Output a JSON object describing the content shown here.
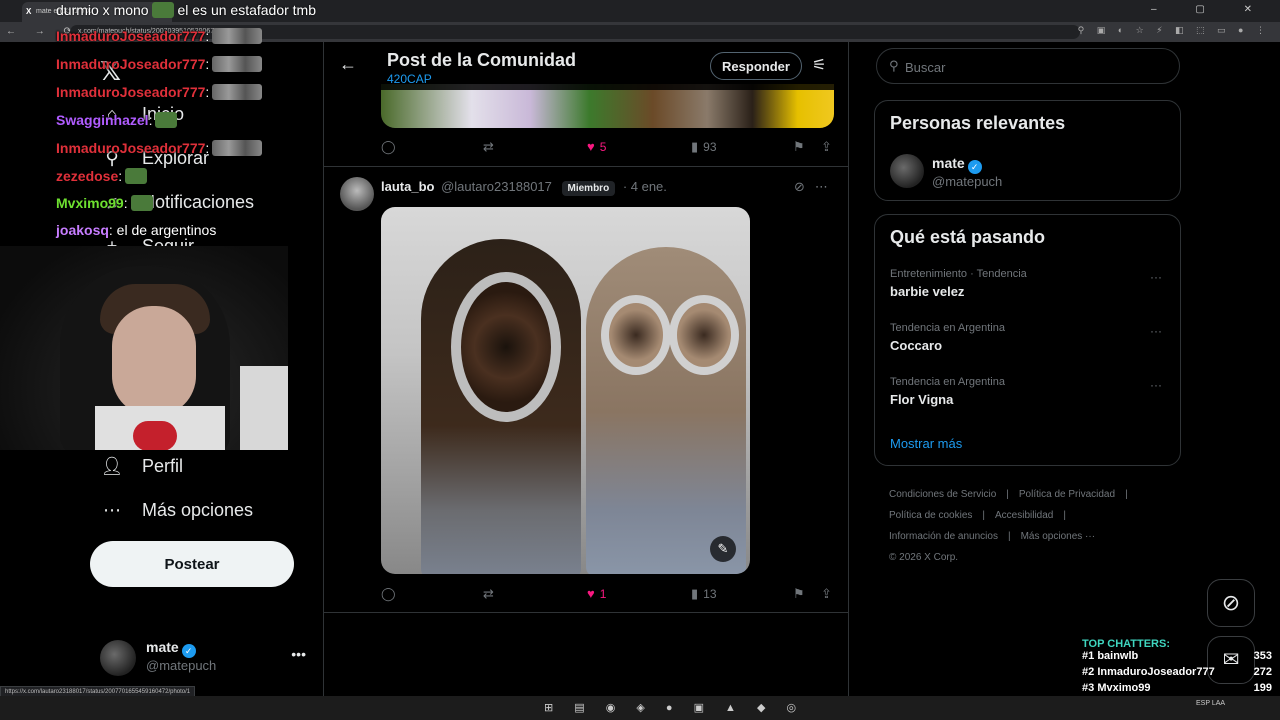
{
  "browser": {
    "tab_title": "mate en X: \"1\" / X",
    "url": "x.com/matepuch/status/2007039510539067771",
    "status_url": "https://x.com/lautaro23188017/status/2007701655459160472/photo/1"
  },
  "stream": {
    "top_message_user": "durmio x mono",
    "top_message_text": "el es un estafador tmb",
    "chat": [
      {
        "user": "InmaduroJoseador777",
        "color": "#e0303a",
        "text": ":"
      },
      {
        "user": "InmaduroJoseador777",
        "color": "#e0303a",
        "text": ":"
      },
      {
        "user": "InmaduroJoseador777",
        "color": "#e0303a",
        "text": ":"
      },
      {
        "user": "Swagginhazel",
        "color": "#b05cff",
        "text": ":"
      },
      {
        "user": "InmaduroJoseador777",
        "color": "#e0303a",
        "text": ":"
      },
      {
        "user": "zezedose",
        "color": "#e0303a",
        "text": ":"
      },
      {
        "user": "Mvximo99",
        "color": "#6ee030",
        "text": ":"
      },
      {
        "user": "joakosq",
        "color": "#c77dff",
        "text": ": el de argentinos"
      }
    ],
    "top_chatters_title": "TOP CHATTERS:",
    "top_chatters": [
      {
        "rank": "#1",
        "name": "bainwlb",
        "count": "353"
      },
      {
        "rank": "#2",
        "name": "InmaduroJoseador777",
        "count": "272"
      },
      {
        "rank": "#3",
        "name": "Mvximo99",
        "count": "199"
      }
    ]
  },
  "sidebar": {
    "items": [
      {
        "label": "Inicio",
        "icon": "home-icon"
      },
      {
        "label": "Explorar",
        "icon": "search-icon"
      },
      {
        "label": "Notificaciones",
        "icon": "bell-icon"
      },
      {
        "label": "Seguir",
        "icon": "follow-icon"
      },
      {
        "label": "Perfil",
        "icon": "person-icon"
      },
      {
        "label": "Más opciones",
        "icon": "more-circle-icon"
      }
    ],
    "post_button": "Postear",
    "account": {
      "name": "mate",
      "handle": "@matepuch"
    }
  },
  "header": {
    "title": "Post de la Comunidad",
    "subtitle": "420CAP",
    "reply_button": "Responder"
  },
  "prev_post": {
    "likes": "5",
    "views": "93"
  },
  "post": {
    "user": "lauta_bo",
    "handle": "@lautaro23188017",
    "badge": "Miembro",
    "date": "· 4 ene.",
    "likes": "1",
    "views": "13"
  },
  "search": {
    "placeholder": "Buscar"
  },
  "relevant": {
    "title": "Personas relevantes",
    "name": "mate",
    "handle": "@matepuch"
  },
  "trends": {
    "title": "Qué está pasando",
    "items": [
      {
        "meta": "Entretenimiento · Tendencia",
        "name": "barbie velez"
      },
      {
        "meta": "Tendencia en Argentina",
        "name": "Coccaro"
      },
      {
        "meta": "Tendencia en Argentina",
        "name": "Flor Vigna"
      }
    ],
    "show_more": "Mostrar más"
  },
  "footer": {
    "links": [
      "Condiciones de Servicio",
      "|",
      "Política de Privacidad",
      "|",
      "Política de cookies",
      "|",
      "Accesibilidad",
      "|",
      "Información de anuncios",
      "|",
      "Más opciones ···"
    ],
    "copyright": "© 2026 X Corp."
  },
  "taskbar": {
    "lang": "ESP LAA"
  }
}
